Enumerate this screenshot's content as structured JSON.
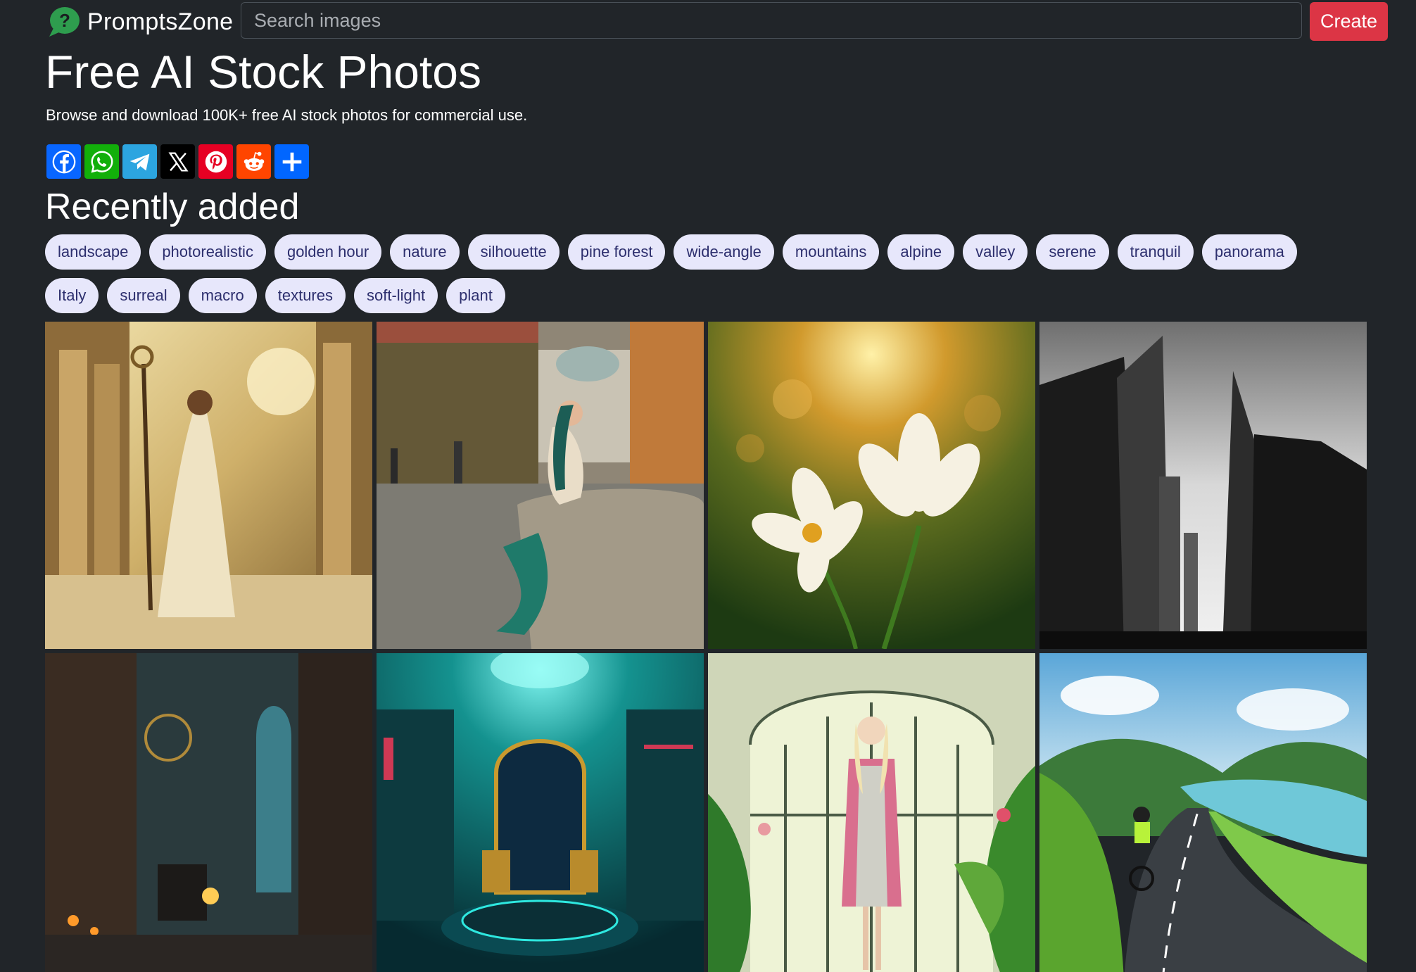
{
  "navbar": {
    "brand_name": "PromptsZone",
    "logo_icon": "question-speech-bubble-icon",
    "search_placeholder": "Search images",
    "create_label": "Create"
  },
  "header": {
    "title": "Free AI Stock Photos",
    "subtitle": "Browse and download 100K+ free AI stock photos for commercial use."
  },
  "share_buttons": [
    {
      "name": "Facebook",
      "icon": "facebook-icon",
      "color": "#0866ff"
    },
    {
      "name": "WhatsApp",
      "icon": "whatsapp-icon",
      "color": "#12af0a"
    },
    {
      "name": "Telegram",
      "icon": "telegram-icon",
      "color": "#2ca5e0"
    },
    {
      "name": "X",
      "icon": "x-icon",
      "color": "#000000"
    },
    {
      "name": "Pinterest",
      "icon": "pinterest-icon",
      "color": "#e60023"
    },
    {
      "name": "Reddit",
      "icon": "reddit-icon",
      "color": "#ff4500"
    },
    {
      "name": "Share",
      "icon": "plus-share-icon",
      "color": "#0166ff"
    }
  ],
  "section_title": "Recently added",
  "tags": [
    "landscape",
    "photorealistic",
    "golden hour",
    "nature",
    "silhouette",
    "pine forest",
    "wide-angle",
    "mountains",
    "alpine",
    "valley",
    "serene",
    "tranquil",
    "panorama",
    "Italy",
    "surreal",
    "macro",
    "textures",
    "soft-light",
    "plant"
  ],
  "photos": [
    {
      "subject": "goddess with staff among temple columns"
    },
    {
      "subject": "mermaid sitting on a fountain in a courtyard"
    },
    {
      "subject": "white flowers in golden sunlight"
    },
    {
      "subject": "black and white skyscrapers"
    },
    {
      "subject": "dark stone hall with candles and a seated figure"
    },
    {
      "subject": "ornate throne in a teal laboratory"
    },
    {
      "subject": "woman in pink coat in a greenhouse"
    },
    {
      "subject": "cyclist on a road through green valley by a lake"
    }
  ],
  "colors": {
    "background": "#212529",
    "create_button": "#dc3545",
    "tag_background": "#e7e7fb",
    "tag_text": "#2d2f6e",
    "brand_icon": "#2e9d4e"
  }
}
